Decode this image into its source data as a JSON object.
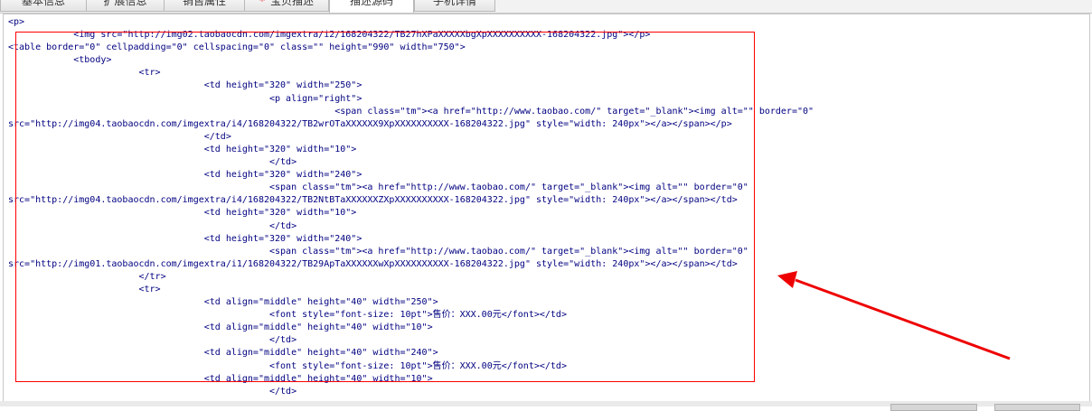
{
  "tabs": [
    {
      "label": "基本信息",
      "required": false,
      "active": false
    },
    {
      "label": "扩展信息",
      "required": false,
      "active": false
    },
    {
      "label": "销售属性",
      "required": false,
      "active": false
    },
    {
      "label": "宝贝描述",
      "required": true,
      "active": false
    },
    {
      "label": "描述源码",
      "required": false,
      "active": true
    },
    {
      "label": "手机详情",
      "required": false,
      "active": false
    }
  ],
  "required_mark": "*",
  "code_lines": [
    "<p>",
    "            <img src=\"http://img02.taobaocdn.com/imgextra/i2/168204322/TB27hXPaXXXXXbgXpXXXXXXXXXX-168204322.jpg\"></p>",
    "<table border=\"0\" cellpadding=\"0\" cellspacing=\"0\" class=\"\" height=\"990\" width=\"750\">",
    "            <tbody>",
    "                        <tr>",
    "                                    <td height=\"320\" width=\"250\">",
    "                                                <p align=\"right\">",
    "                                                            <span class=\"tm\"><a href=\"http://www.taobao.com/\" target=\"_blank\"><img alt=\"\" border=\"0\"",
    "src=\"http://img04.taobaocdn.com/imgextra/i4/168204322/TB2wrOTaXXXXXX9XpXXXXXXXXXX-168204322.jpg\" style=\"width: 240px\"></a></span></p>",
    "                                    </td>",
    "                                    <td height=\"320\" width=\"10\">",
    "                                                </td>",
    "                                    <td height=\"320\" width=\"240\">",
    "                                                <span class=\"tm\"><a href=\"http://www.taobao.com/\" target=\"_blank\"><img alt=\"\" border=\"0\"",
    "src=\"http://img04.taobaocdn.com/imgextra/i4/168204322/TB2NtBTaXXXXXXZXpXXXXXXXXXX-168204322.jpg\" style=\"width: 240px\"></a></span></td>",
    "                                    <td height=\"320\" width=\"10\">",
    "                                                </td>",
    "                                    <td height=\"320\" width=\"240\">",
    "                                                <span class=\"tm\"><a href=\"http://www.taobao.com/\" target=\"_blank\"><img alt=\"\" border=\"0\"",
    "src=\"http://img01.taobaocdn.com/imgextra/i1/168204322/TB29ApTaXXXXXXwXpXXXXXXXXXX-168204322.jpg\" style=\"width: 240px\"></a></span></td>",
    "                        </tr>",
    "                        <tr>",
    "                                    <td align=\"middle\" height=\"40\" width=\"250\">",
    "                                                <font style=\"font-size: 10pt\">售价：XXX.00元</font></td>",
    "                                    <td align=\"middle\" height=\"40\" width=\"10\">",
    "                                                </td>",
    "                                    <td align=\"middle\" height=\"40\" width=\"240\">",
    "                                                <font style=\"font-size: 10pt\">售价：XXX.00元</font></td>",
    "                                    <td align=\"middle\" height=\"40\" width=\"10\">",
    "                                                </td>"
  ],
  "colors": {
    "code_text": "#000080",
    "highlight": "#ff0000",
    "arrow": "#ee0000"
  }
}
